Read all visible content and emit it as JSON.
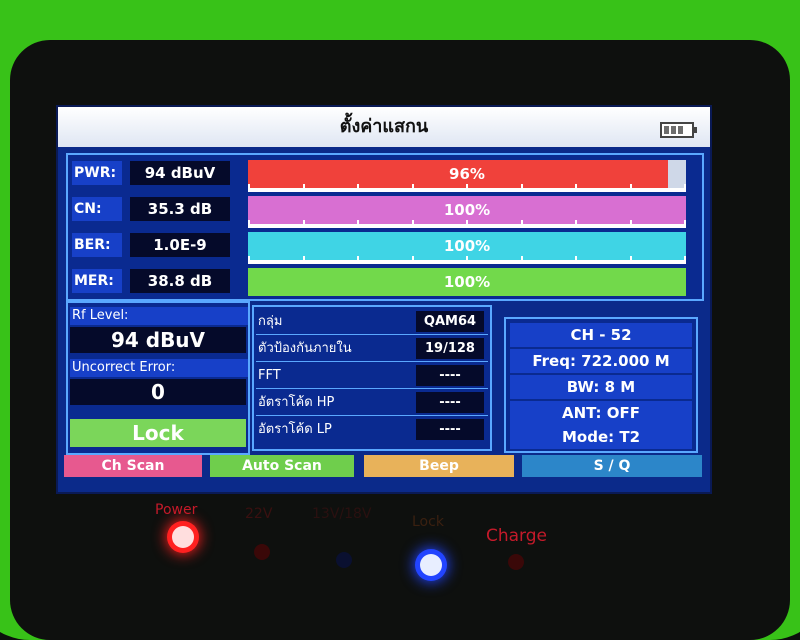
{
  "title": "ตั้งค่าแสกน",
  "meters": [
    {
      "label": "PWR:",
      "value": "94 dBuV",
      "percent": 96,
      "percent_text": "96%",
      "color": "#f0413b"
    },
    {
      "label": "CN:",
      "value": "35.3 dB",
      "percent": 100,
      "percent_text": "100%",
      "color": "#d86fd2"
    },
    {
      "label": "BER:",
      "value": "1.0E-9",
      "percent": 100,
      "percent_text": "100%",
      "color": "#3fd4e5"
    },
    {
      "label": "MER:",
      "value": "38.8 dB",
      "percent": 100,
      "percent_text": "100%",
      "color": "#72d94b"
    }
  ],
  "left_info": {
    "rf_label": "Rf Level:",
    "rf_value": "94 dBuV",
    "uncorrect_label": "Uncorrect Error:",
    "uncorrect_value": "0",
    "lock": "Lock"
  },
  "mid_info": [
    {
      "label": "กลุ่ม",
      "value": "QAM64"
    },
    {
      "label": "ตัวป้องกันภายใน",
      "value": "19/128"
    },
    {
      "label": "FFT",
      "value": "----"
    },
    {
      "label": "อัตราโค้ด HP",
      "value": "----"
    },
    {
      "label": "อัตราโค้ด LP",
      "value": "----"
    }
  ],
  "right_info": [
    "CH - 52",
    "Freq: 722.000 M",
    "BW: 8 M",
    "ANT: OFF",
    "Mode: T2"
  ],
  "softkeys": [
    {
      "label": "Ch Scan",
      "color": "#e7598f"
    },
    {
      "label": "Auto Scan",
      "color": "#6fce4c"
    },
    {
      "label": "Beep",
      "color": "#e8b25a"
    },
    {
      "label": "S / Q",
      "color": "#2c86c9"
    }
  ],
  "leds": [
    {
      "label": "Power",
      "color": "#ff2020",
      "on": true
    },
    {
      "label": "22V",
      "color": "#ff2020",
      "on": false
    },
    {
      "label": "13V/18V",
      "color": "#2244ff",
      "on": false
    },
    {
      "label": "Lock",
      "color": "#2244ff",
      "on": true
    },
    {
      "label": "Charge",
      "color": "#ff2020",
      "on": false
    }
  ]
}
